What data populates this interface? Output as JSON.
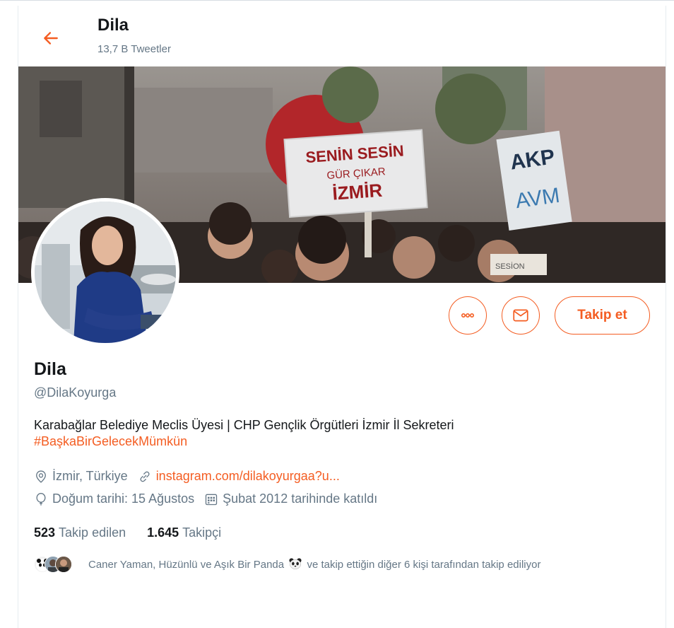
{
  "header": {
    "title": "Dila",
    "tweet_count": "13,7 B Tweetler"
  },
  "banner": {
    "sign_main": [
      "SENİN SESİN",
      "GÜR ÇIKAR",
      "İZMİR"
    ],
    "sign_right": [
      "AKP",
      "AVM"
    ],
    "sign_bottom": "SESİON"
  },
  "actions": {
    "follow_label": "Takip et"
  },
  "profile": {
    "name": "Dila",
    "handle": "@DilaKoyurga",
    "bio": "Karabağlar Belediye Meclis Üyesi | CHP Gençlik Örgütleri İzmir İl Sekreteri",
    "hashtag": "#BaşkaBirGelecekMümkün",
    "location": "İzmir, Türkiye",
    "website": "instagram.com/dilakoyurgaa?u...",
    "birthday": "Doğum tarihi: 15 Ağustos",
    "joined": "Şubat 2012 tarihinde katıldı"
  },
  "stats": {
    "following_count": "523",
    "following_label": "Takip edilen",
    "followers_count": "1.645",
    "followers_label": "Takipçi"
  },
  "followed_by": {
    "text_before": "Caner Yaman, Hüzünlü ve Aşık Bir Panda",
    "text_after": "ve takip ettiğin diğer 6 kişi tarafından takip ediliyor"
  },
  "colors": {
    "accent": "#f45d22",
    "secondary_text": "#657786",
    "primary_text": "#14171a",
    "border": "#e6ecf0"
  },
  "icons": {
    "back": "arrow-left-icon",
    "more": "ellipsis-icon",
    "message": "envelope-icon",
    "location": "map-pin-icon",
    "website": "link-icon",
    "birthday": "balloon-icon",
    "joined": "calendar-icon"
  }
}
